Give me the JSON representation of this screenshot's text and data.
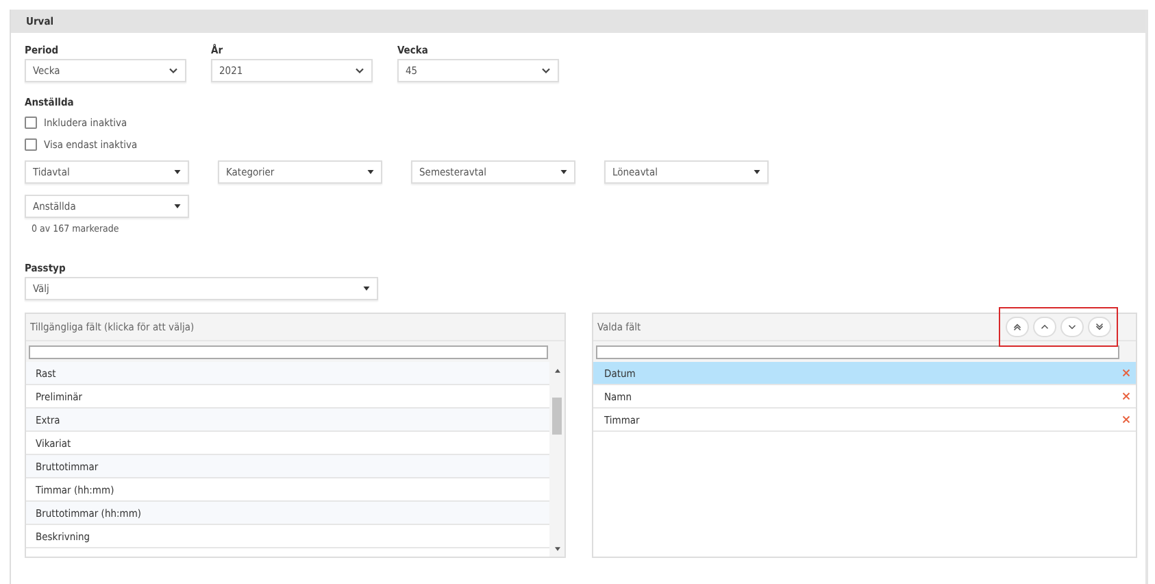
{
  "section_title": "Urval",
  "selects": [
    {
      "label": "Period",
      "value": "Vecka"
    },
    {
      "label": "År",
      "value": "2021"
    },
    {
      "label": "Vecka",
      "value": "45"
    }
  ],
  "employees": {
    "label": "Anställda",
    "checkboxes": [
      {
        "label": "Inkludera inaktiva",
        "checked": false
      },
      {
        "label": "Visa endast inaktiva",
        "checked": false
      }
    ],
    "filters": [
      "Tidavtal",
      "Kategorier",
      "Semesteravtal",
      "Löneavtal"
    ],
    "employee_dropdown": "Anställda",
    "count": "0 av 167 markerade"
  },
  "shift_type": {
    "label": "Passtyp",
    "value": "Välj"
  },
  "available_fields": {
    "title": "Tillgängliga fält (klicka för att välja)",
    "items": [
      "Rast",
      "Preliminär",
      "Extra",
      "Vikariat",
      "Bruttotimmar",
      "Timmar (hh:mm)",
      "Bruttotimmar (hh:mm)",
      "Beskrivning"
    ]
  },
  "selected_fields": {
    "title": "Valda fält",
    "highlighted": true,
    "buttons": [
      {
        "kind": "top"
      },
      {
        "kind": "up"
      },
      {
        "kind": "down"
      },
      {
        "kind": "bottom"
      }
    ],
    "items": [
      {
        "label": "Datum",
        "selected": true
      },
      {
        "label": "Namn",
        "selected": false
      },
      {
        "label": "Timmar",
        "selected": false
      }
    ]
  }
}
